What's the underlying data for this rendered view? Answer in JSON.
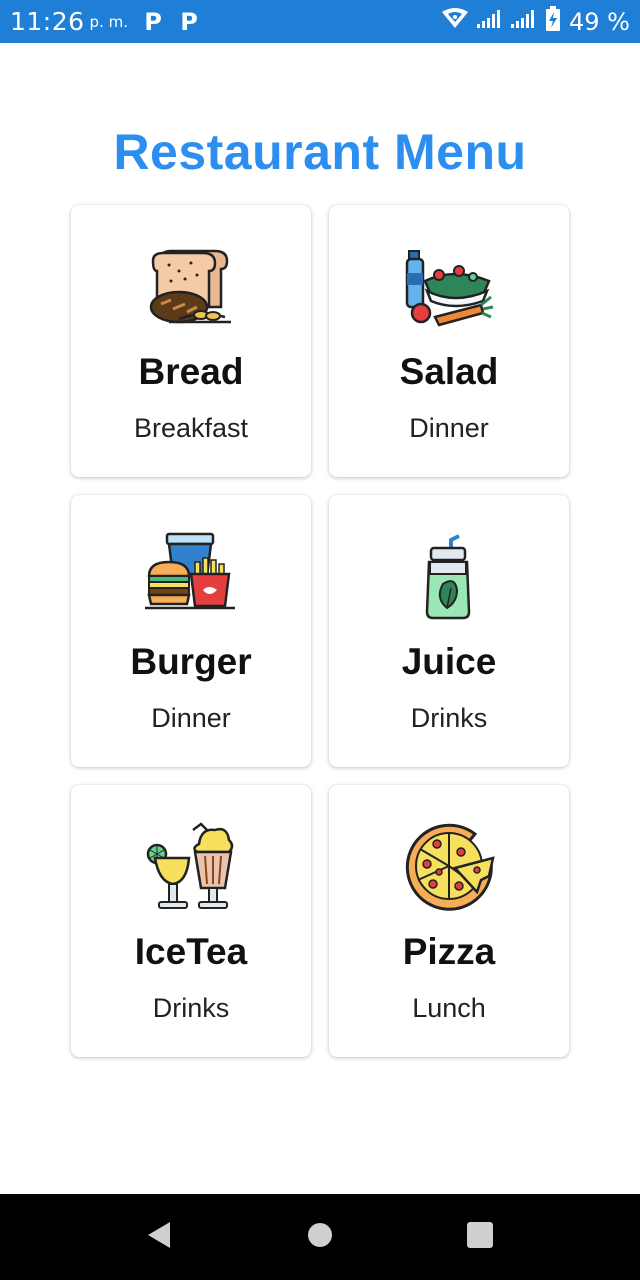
{
  "status_bar": {
    "time": "11:26",
    "ampm": "p. m.",
    "notification_icons": [
      "P",
      "P"
    ],
    "battery": "49 %"
  },
  "page": {
    "title": "Restaurant Menu"
  },
  "menu": {
    "items": [
      {
        "name": "Bread",
        "category": "Breakfast",
        "icon": "bread-icon"
      },
      {
        "name": "Salad",
        "category": "Dinner",
        "icon": "salad-icon"
      },
      {
        "name": "Burger",
        "category": "Dinner",
        "icon": "burger-icon"
      },
      {
        "name": "Juice",
        "category": "Drinks",
        "icon": "juice-icon"
      },
      {
        "name": "IceTea",
        "category": "Drinks",
        "icon": "icetea-icon"
      },
      {
        "name": "Pizza",
        "category": "Lunch",
        "icon": "pizza-icon"
      }
    ]
  },
  "colors": {
    "status_bar": "#1f7fd6",
    "title": "#2d8ef0",
    "nav_bar": "#000000"
  }
}
